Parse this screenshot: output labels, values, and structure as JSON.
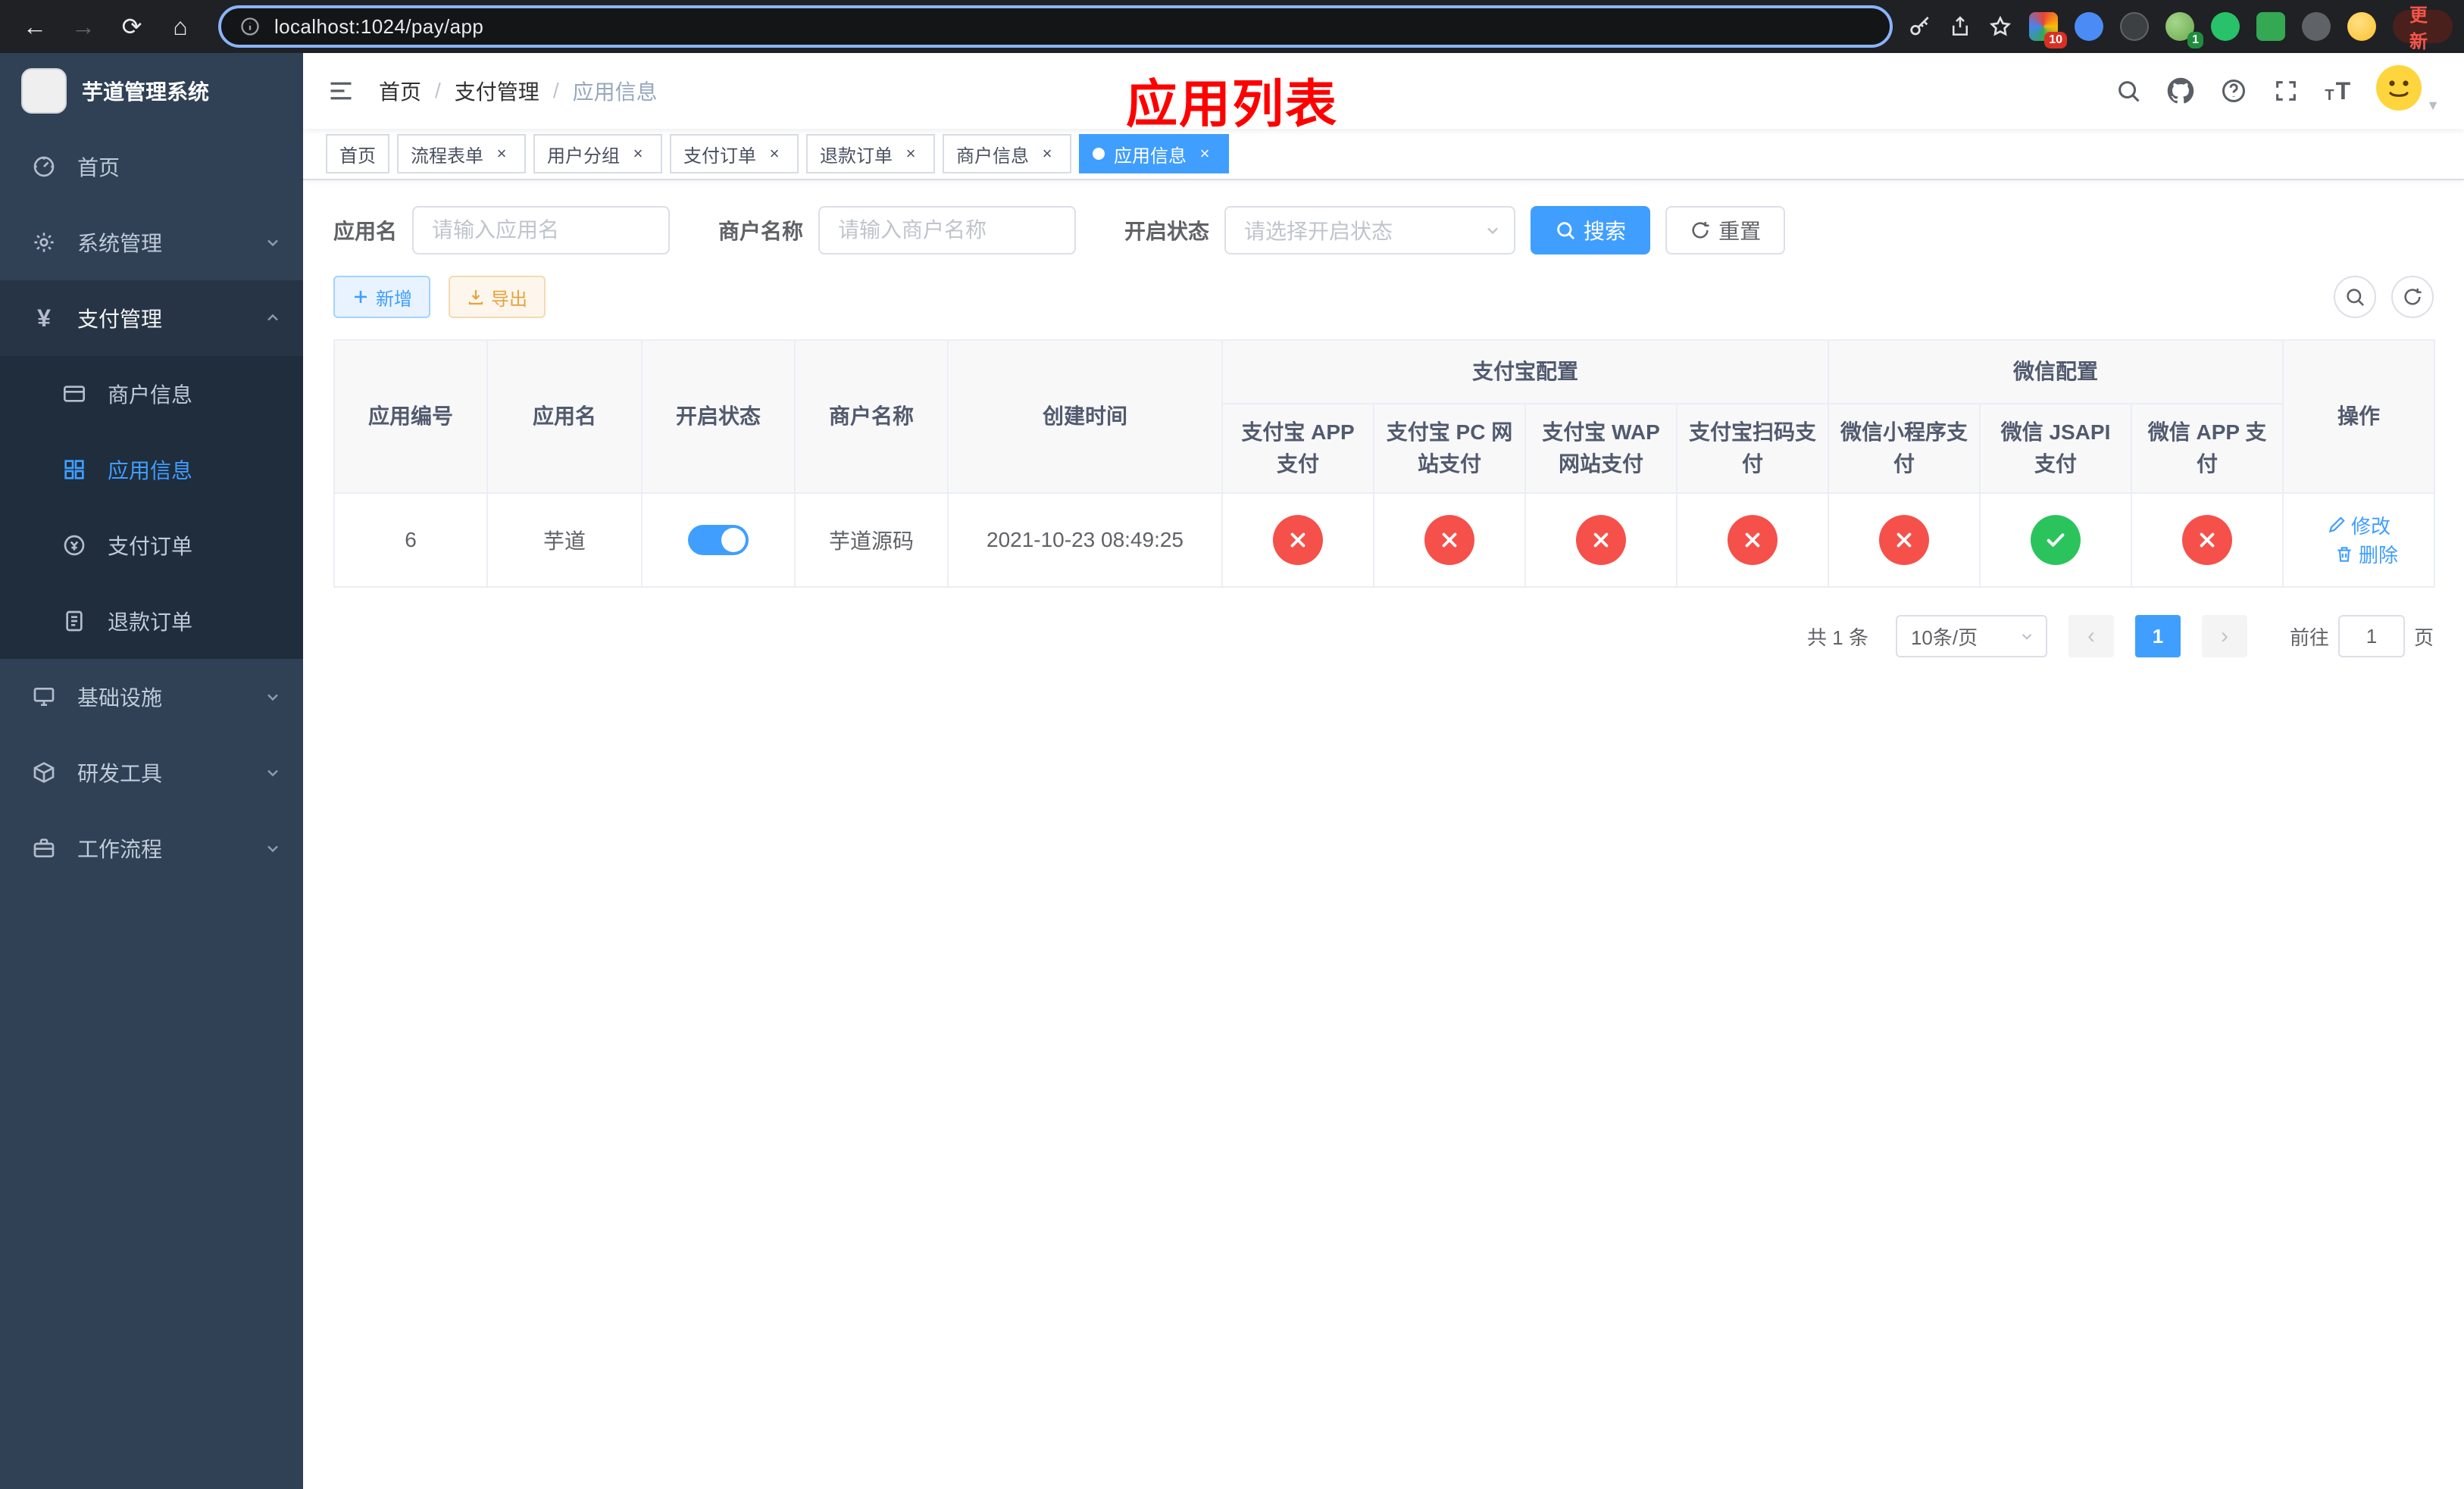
{
  "browser": {
    "url": "localhost:1024/pay/app",
    "update_label": "更新",
    "ext_badge_1": "10",
    "ext_badge_2": "1"
  },
  "sidebar": {
    "title": "芋道管理系统",
    "items": [
      {
        "label": "首页"
      },
      {
        "label": "系统管理"
      },
      {
        "label": "支付管理",
        "children": [
          {
            "label": "商户信息"
          },
          {
            "label": "应用信息"
          },
          {
            "label": "支付订单"
          },
          {
            "label": "退款订单"
          }
        ]
      },
      {
        "label": "基础设施"
      },
      {
        "label": "研发工具"
      },
      {
        "label": "工作流程"
      }
    ]
  },
  "header": {
    "breadcrumb": [
      "首页",
      "支付管理",
      "应用信息"
    ],
    "annotation": "应用列表"
  },
  "tabs": [
    {
      "label": "首页"
    },
    {
      "label": "流程表单"
    },
    {
      "label": "用户分组"
    },
    {
      "label": "支付订单"
    },
    {
      "label": "退款订单"
    },
    {
      "label": "商户信息"
    },
    {
      "label": "应用信息"
    }
  ],
  "filters": {
    "app_name_label": "应用名",
    "app_name_placeholder": "请输入应用名",
    "merchant_label": "商户名称",
    "merchant_placeholder": "请输入商户名称",
    "status_label": "开启状态",
    "status_placeholder": "请选择开启状态",
    "search_button": "搜索",
    "reset_button": "重置"
  },
  "toolbar": {
    "add_button": "新增",
    "export_button": "导出"
  },
  "table": {
    "group_alipay": "支付宝配置",
    "group_wechat": "微信配置",
    "col_id": "应用编号",
    "col_name": "应用名",
    "col_status": "开启状态",
    "col_merchant": "商户名称",
    "col_created": "创建时间",
    "col_alipay_app": "支付宝 APP 支付",
    "col_alipay_pc": "支付宝 PC 网站支付",
    "col_alipay_wap": "支付宝 WAP 网站支付",
    "col_alipay_qr": "支付宝扫码支付",
    "col_wx_mini": "微信小程序支付",
    "col_wx_jsapi": "微信 JSAPI 支付",
    "col_wx_app": "微信 APP 支付",
    "col_actions": "操作",
    "row": {
      "id": "6",
      "name": "芋道",
      "enabled": true,
      "merchant": "芋道源码",
      "created": "2021-10-23 08:49:25",
      "channels": [
        false,
        false,
        false,
        false,
        false,
        true,
        false
      ],
      "edit": "修改",
      "del": "删除"
    }
  },
  "pagination": {
    "total": "共 1 条",
    "size": "10条/页",
    "page": "1",
    "prev": "‹",
    "next": "›",
    "goto_label": "前往",
    "goto_value": "1",
    "goto_unit": "页"
  },
  "colors": {
    "accent": "#409eff",
    "success": "#2bc45c",
    "danger": "#f5504a",
    "annotation_red": "#ff0000",
    "sidebar_bg": "#304156",
    "submenu_bg": "#1f2d3d"
  }
}
